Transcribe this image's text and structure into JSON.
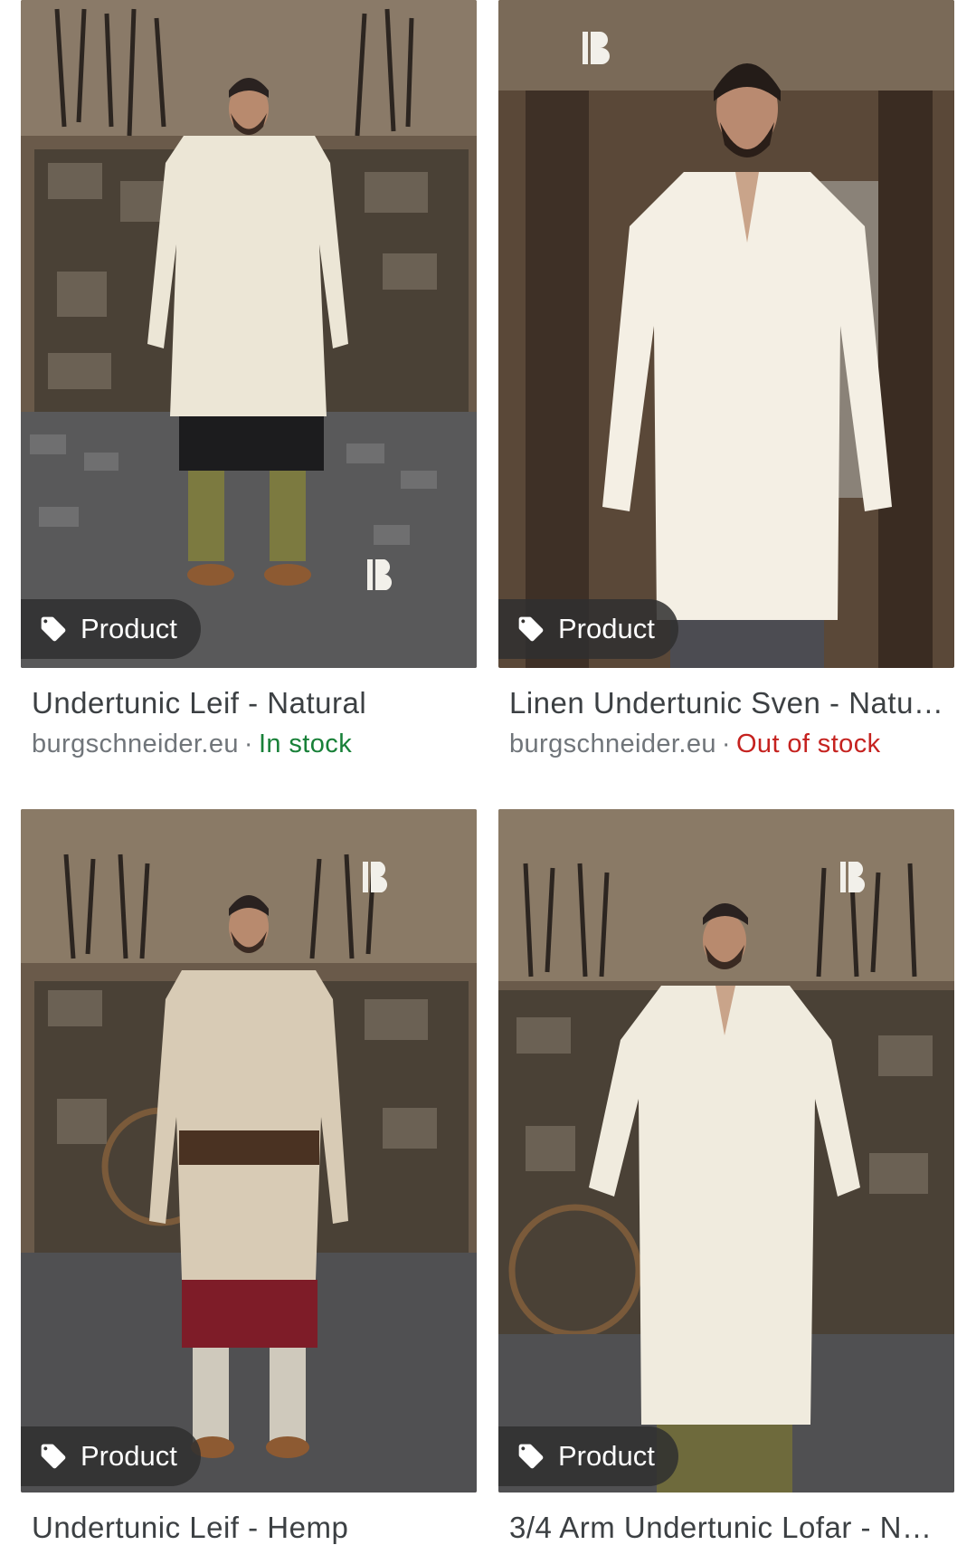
{
  "colors": {
    "in_stock": "#188038",
    "out_of_stock": "#c5221f",
    "title_text": "#3c4043",
    "meta_text": "#70757a"
  },
  "separator": "·",
  "results": [
    {
      "chip_icon": "tag-icon",
      "chip_label": "Product",
      "title": "Undertunic Leif - Natural",
      "source": "burgschneider.eu",
      "stock": "In stock"
    },
    {
      "chip_icon": "tag-icon",
      "chip_label": "Product",
      "title": "Linen Undertunic Sven - Natu…",
      "source": "burgschneider.eu",
      "stock": "Out of stock"
    },
    {
      "chip_icon": "tag-icon",
      "chip_label": "Product",
      "title": "Undertunic Leif - Hemp"
    },
    {
      "chip_icon": "tag-icon",
      "chip_label": "Product",
      "title": "3/4 Arm Undertunic Lofar - N…"
    }
  ]
}
